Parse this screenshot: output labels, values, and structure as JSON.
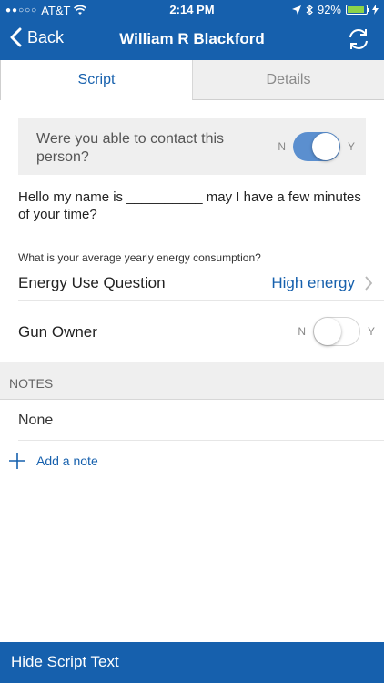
{
  "status": {
    "carrier": "AT&T",
    "time": "2:14 PM",
    "battery": "92%",
    "battery_level": 0.92
  },
  "nav": {
    "back_label": "Back",
    "title": "William R Blackford"
  },
  "tabs": [
    {
      "label": "Script",
      "active": true
    },
    {
      "label": "Details",
      "active": false
    }
  ],
  "contact": {
    "question": "Were you able to contact this person?",
    "no_label": "N",
    "yes_label": "Y",
    "value": true
  },
  "script_text": "Hello my name is __________ may I have a few minutes of your time?",
  "energy": {
    "prompt": "What is your average yearly energy consumption?",
    "label": "Energy Use Question",
    "value": "High energy"
  },
  "gun": {
    "label": "Gun Owner",
    "no_label": "N",
    "yes_label": "Y",
    "value": false
  },
  "notes": {
    "header": "NOTES",
    "items": [
      "None"
    ],
    "add_label": "Add a note"
  },
  "bottom": {
    "label": "Hide Script Text"
  },
  "colors": {
    "brand": "#1660ad",
    "toggle_on": "#5b8fcf"
  }
}
